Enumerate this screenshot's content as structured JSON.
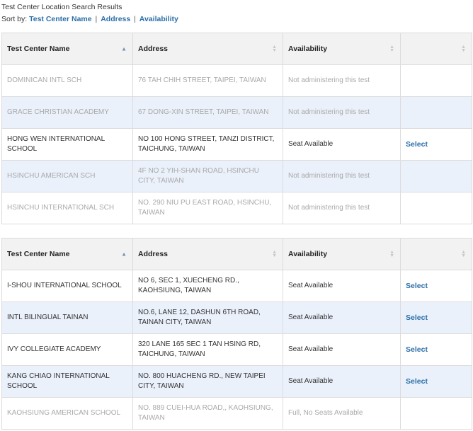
{
  "page": {
    "title": "Test Center Location Search Results",
    "sort_prefix": "Sort by:",
    "sort_links": [
      "Test Center Name",
      "Address",
      "Availability"
    ],
    "separator": "|"
  },
  "columns": {
    "name": "Test Center Name",
    "address": "Address",
    "availability": "Availability"
  },
  "colors": {
    "link": "#2c6fa8",
    "alt_row": "#eaf1fb",
    "header_bg": "#f2f2f2",
    "muted_text": "#a9a9a9"
  },
  "tables": [
    {
      "rows": [
        {
          "name": "DOMINICAN INTL SCH",
          "address": "76 TAH CHIH STREET, TAIPEI, TAIWAN",
          "availability": "Not administering this test",
          "action": ""
        },
        {
          "name": "GRACE CHRISTIAN ACADEMY",
          "address": "67 DONG-XIN STREET, TAIPEI, TAIWAN",
          "availability": "Not administering this test",
          "action": ""
        },
        {
          "name": "HONG WEN INTERNATIONAL SCHOOL",
          "address": "NO 100 HONG STREET, TANZI DISTRICT, TAICHUNG, TAIWAN",
          "availability": "Seat Available",
          "action": "Select"
        },
        {
          "name": "HSINCHU AMERICAN SCH",
          "address": "4F NO 2 YIH-SHAN ROAD, HSINCHU CITY, TAIWAN",
          "availability": "Not administering this test",
          "action": ""
        },
        {
          "name": "HSINCHU INTERNATIONAL SCH",
          "address": "NO. 290 NIU PU EAST ROAD, HSINCHU, TAIWAN",
          "availability": "Not administering this test",
          "action": ""
        }
      ]
    },
    {
      "rows": [
        {
          "name": "I-SHOU INTERNATIONAL SCHOOL",
          "address": "NO 6, SEC 1, XUECHENG RD., KAOHSIUNG, TAIWAN",
          "availability": "Seat Available",
          "action": "Select"
        },
        {
          "name": "INTL BILINGUAL TAINAN",
          "address": "NO.6, LANE 12, DASHUN 6TH ROAD, TAINAN CITY, TAIWAN",
          "availability": "Seat Available",
          "action": "Select"
        },
        {
          "name": "IVY COLLEGIATE ACADEMY",
          "address": "320 LANE 165 SEC 1 TAN HSING RD, TAICHUNG, TAIWAN",
          "availability": "Seat Available",
          "action": "Select"
        },
        {
          "name": "KANG CHIAO INTERNATIONAL SCHOOL",
          "address": "NO. 800 HUACHENG RD., NEW TAIPEI CITY, TAIWAN",
          "availability": "Seat Available",
          "action": "Select"
        },
        {
          "name": "KAOHSIUNG AMERICAN SCHOOL",
          "address": "NO. 889 CUEI-HUA ROAD,, KAOHSIUNG, TAIWAN",
          "availability": "Full, No Seats Available",
          "action": ""
        }
      ]
    }
  ]
}
